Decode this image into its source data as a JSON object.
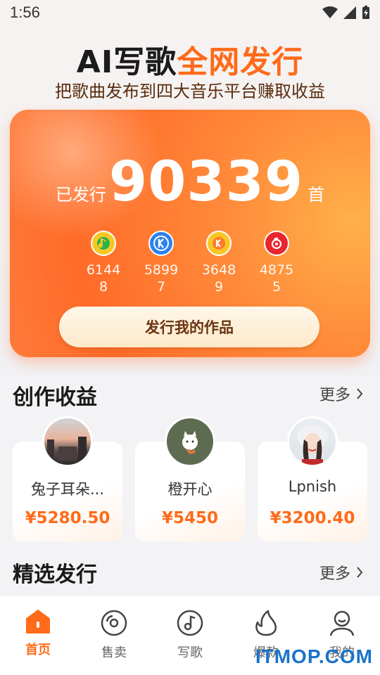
{
  "status_bar": {
    "time": "1:56"
  },
  "header": {
    "title_dark": "AI写歌",
    "title_orange": "全网发行",
    "subtitle": "把歌曲发布到四大音乐平台赚取收益"
  },
  "release_card": {
    "prefix": "已发行",
    "count": "90339",
    "suffix": "首",
    "platforms": [
      {
        "icon": "qq-music-icon",
        "count": "61448",
        "color": "#f7c825"
      },
      {
        "icon": "kugou-icon",
        "count": "58997",
        "color": "#2a82f0"
      },
      {
        "icon": "kuwo-icon",
        "count": "36489",
        "color": "#f7c825"
      },
      {
        "icon": "netease-music-icon",
        "count": "48755",
        "color": "#e8262e"
      }
    ],
    "button_label": "发行我的作品"
  },
  "earnings": {
    "title": "创作收益",
    "more": "更多",
    "items": [
      {
        "name": "兔子耳朵...",
        "amount": "¥5280.50"
      },
      {
        "name": "橙开心",
        "amount": "¥5450"
      },
      {
        "name": "Lpnish",
        "amount": "¥3200.40"
      }
    ]
  },
  "featured": {
    "title": "精选发行",
    "more": "更多"
  },
  "bottom_nav": [
    {
      "label": "首页",
      "icon": "home-icon",
      "active": true
    },
    {
      "label": "售卖",
      "icon": "disc-icon",
      "active": false
    },
    {
      "label": "写歌",
      "icon": "music-note-icon",
      "active": false
    },
    {
      "label": "爆款",
      "icon": "flame-icon",
      "active": false
    },
    {
      "label": "我的",
      "icon": "profile-icon",
      "active": false
    }
  ],
  "watermark": "ITMOP.COM",
  "colors": {
    "accent": "#ff6b1a",
    "brown": "#5a2c0e"
  }
}
